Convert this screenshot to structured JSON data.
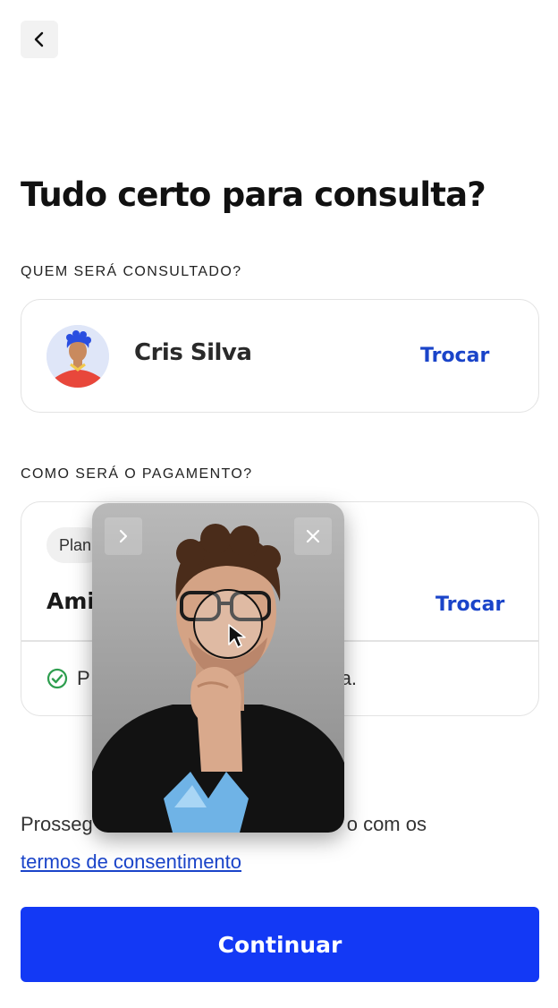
{
  "header": {
    "back_icon": "chevron-left-icon"
  },
  "page": {
    "title": "Tudo certo para consulta?"
  },
  "patient_section": {
    "label": "QUEM SERÁ CONSULTADO?",
    "name": "Cris Silva",
    "change_label": "Trocar",
    "avatar_icon": "avatar-illustration"
  },
  "payment_section": {
    "label": "COMO SERÁ O PAGAMENTO?",
    "plan_chip": "Plan",
    "plan_name": "Ami",
    "change_label": "Trocar",
    "coverage_prefix": "P",
    "coverage_suffix": "a.",
    "check_icon": "check-circle-icon"
  },
  "consent": {
    "text_start": "Prosseg",
    "text_end": "o com os",
    "link_label": "termos de consentimento"
  },
  "actions": {
    "continue_label": "Continuar"
  },
  "video_overlay": {
    "expand_icon": "chevron-right-icon",
    "close_icon": "close-icon",
    "cursor_icon": "pointer-cursor-icon"
  },
  "colors": {
    "accent": "#1339f5",
    "link": "#1a44c9",
    "success": "#2e9e4f"
  }
}
